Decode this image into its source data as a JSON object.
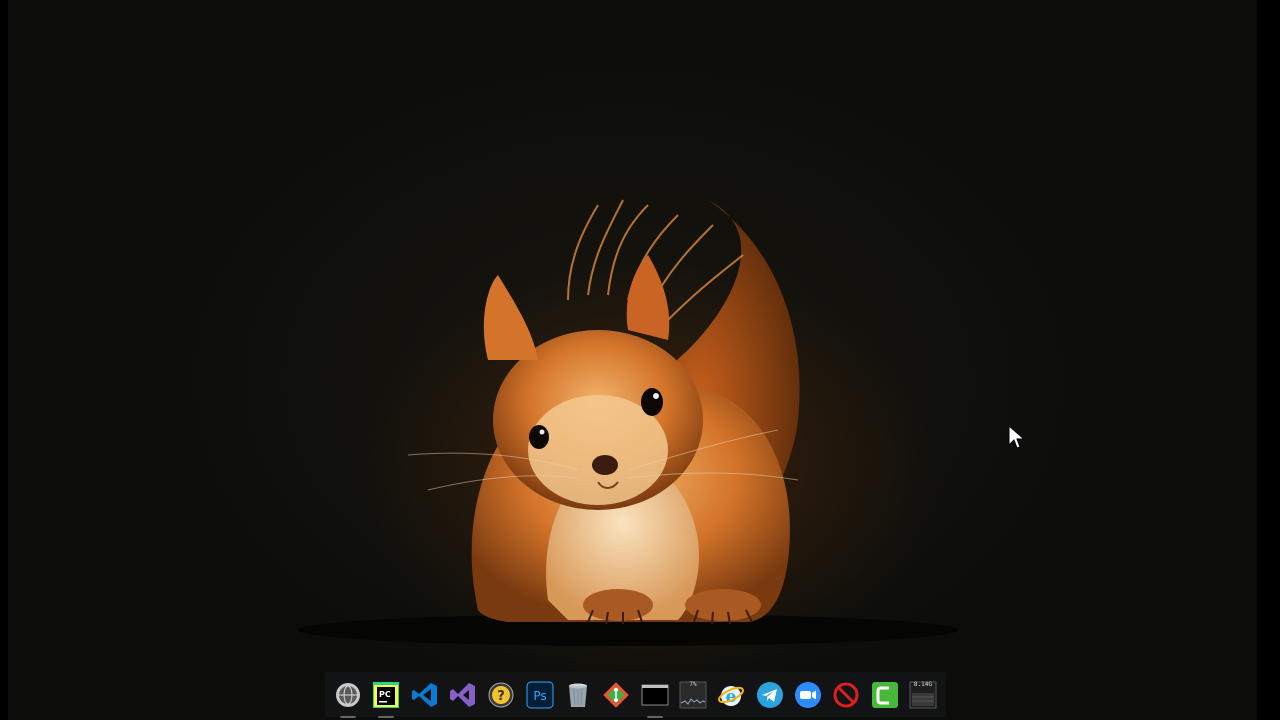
{
  "desktop": {
    "wallpaper": "squirrel-photo",
    "background_color": "#0c0d0a"
  },
  "dock": {
    "items": [
      {
        "id": "system-settings",
        "icon": "globe-gear-icon",
        "running": true
      },
      {
        "id": "pycharm",
        "icon": "pycharm-icon",
        "label": "PC",
        "running": true
      },
      {
        "id": "vscode",
        "icon": "vscode-icon",
        "running": false
      },
      {
        "id": "visual-studio",
        "icon": "visual-studio-icon",
        "running": false
      },
      {
        "id": "help",
        "icon": "help-icon",
        "running": false
      },
      {
        "id": "photoshop",
        "icon": "photoshop-icon",
        "label": "Ps",
        "running": false
      },
      {
        "id": "trash",
        "icon": "trash-icon",
        "running": false
      },
      {
        "id": "git",
        "icon": "git-icon",
        "running": false
      },
      {
        "id": "terminal",
        "icon": "terminal-icon",
        "running": true
      },
      {
        "id": "cpu-monitor",
        "icon": "cpu-monitor-icon",
        "label": "7%",
        "running": false
      },
      {
        "id": "internet-explorer",
        "icon": "ie-icon",
        "running": false
      },
      {
        "id": "telegram",
        "icon": "telegram-icon",
        "running": false
      },
      {
        "id": "zoom",
        "icon": "zoom-icon",
        "running": false
      },
      {
        "id": "blocker",
        "icon": "no-entry-icon",
        "running": false
      },
      {
        "id": "camtasia",
        "icon": "camtasia-icon",
        "running": false
      },
      {
        "id": "memory-monitor",
        "icon": "memory-monitor-icon",
        "label": "8.14G",
        "running": false
      }
    ]
  },
  "colors": {
    "dock_bg": "#141416",
    "pycharm_green": "#21d789",
    "vscode_blue": "#0a7ad4",
    "vs_purple": "#8661c5",
    "ps_blue": "#31a8ff",
    "telegram_blue": "#2aa3de",
    "zoom_blue": "#2d8cff",
    "camtasia_green": "#46b83a",
    "no_entry_red": "#e01e1e"
  }
}
